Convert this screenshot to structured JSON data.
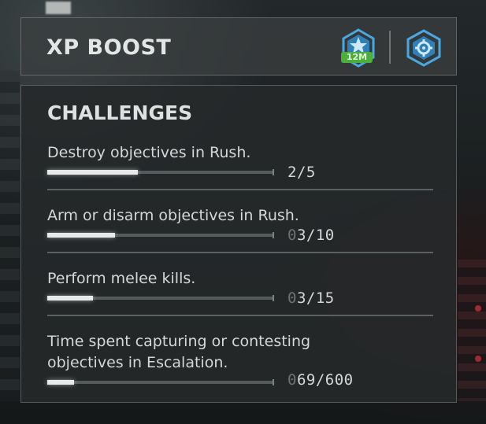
{
  "header": {
    "title": "XP BOOST",
    "boost_badge": "12M",
    "boost_icon": "star-hexagon-icon",
    "settings_icon": "gear-hexagon-icon",
    "accent": "#4aa8e0",
    "badge_color": "#4caf39"
  },
  "challenges": {
    "title": "CHALLENGES",
    "items": [
      {
        "label": "Destroy objectives in Rush.",
        "prefix": "",
        "count": "2/5",
        "current": 2,
        "total": 5
      },
      {
        "label": "Arm or disarm objectives in Rush.",
        "prefix": "0",
        "count": "3/10",
        "current": 3,
        "total": 10
      },
      {
        "label": "Perform melee kills.",
        "prefix": "0",
        "count": "3/15",
        "current": 3,
        "total": 15
      },
      {
        "label": "Time spent capturing or contesting\nobjectives in Escalation.",
        "prefix": "0",
        "count": "69/600",
        "current": 69,
        "total": 600
      }
    ]
  }
}
